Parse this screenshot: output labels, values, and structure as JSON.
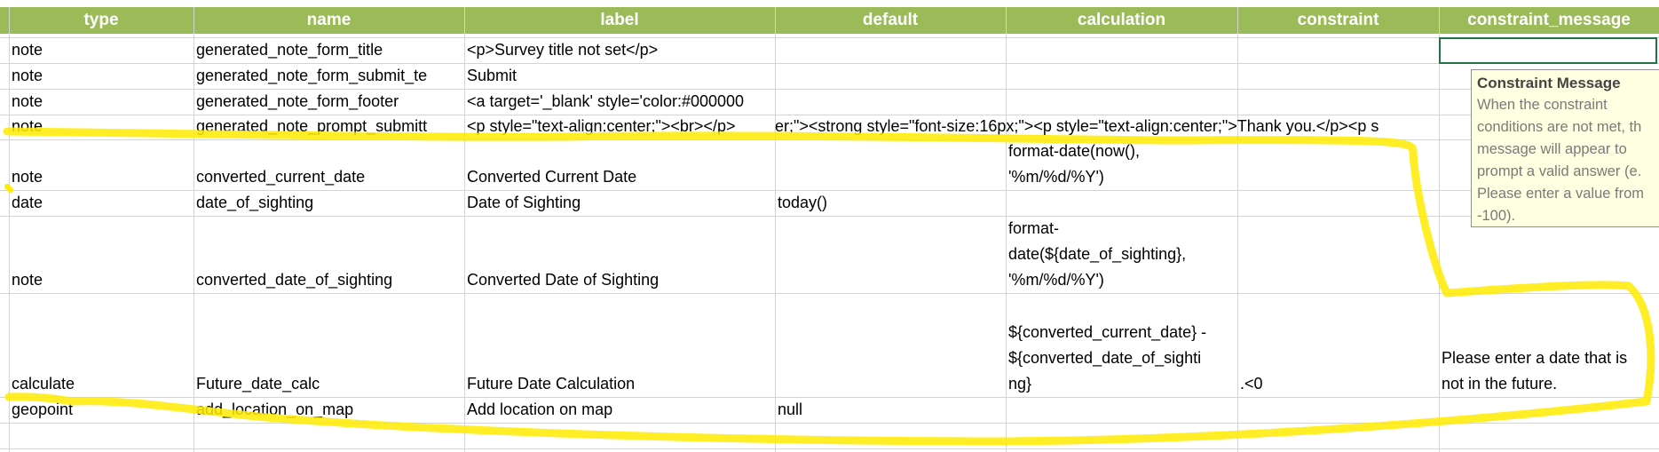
{
  "colors": {
    "header_bg": "#9bbb59",
    "header_text": "#ffffff",
    "grid": "#d4d4d4",
    "selection": "#217346",
    "tooltip_bg": "#ffffe1",
    "highlight": "#ffeb00"
  },
  "headers": [
    "type",
    "name",
    "label",
    "default",
    "calculation",
    "constraint",
    "constraint_message"
  ],
  "rows": [
    {
      "type": "note",
      "name": "generated_note_form_title",
      "label": "<p>Survey title not set</p>",
      "default": "",
      "calculation": [],
      "constraint": "",
      "constraint_message": []
    },
    {
      "type": "note",
      "name": "generated_note_form_submit_te",
      "label": "Submit",
      "default": "",
      "calculation": [],
      "constraint": "",
      "constraint_message": []
    },
    {
      "type": "note",
      "name": "generated_note_form_footer",
      "label": "<a target='_blank' style='color:#000000",
      "default": "",
      "calculation": [],
      "constraint": "",
      "constraint_message": []
    },
    {
      "type": "note",
      "name": "generated_note_prompt_submitt",
      "label": "<p style=\"text-align:center;\"><br></p>",
      "label_overflow": "er;\"><strong style=\"font-size:16px;\"><p style=\"text-align:center;\">Thank you.</p><p s",
      "default": "",
      "calculation": [],
      "constraint": "",
      "constraint_message": []
    },
    {
      "type": "note",
      "name": "converted_current_date",
      "label": "Converted Current Date",
      "default": "",
      "calculation": [
        "format-date(now(),",
        "'%m/%d/%Y')"
      ],
      "constraint": "",
      "constraint_message": []
    },
    {
      "type": "date",
      "name": "date_of_sighting",
      "label": "Date of Sighting",
      "default": "today()",
      "calculation": [],
      "constraint": "",
      "constraint_message": []
    },
    {
      "type": "note",
      "name": "converted_date_of_sighting",
      "label": "Converted Date of Sighting",
      "default": "",
      "calculation": [
        "format-",
        "date(${date_of_sighting},",
        "'%m/%d/%Y')"
      ],
      "constraint": "",
      "constraint_message": []
    },
    {
      "type": "calculate",
      "name": "Future_date_calc",
      "label": "Future Date Calculation",
      "default": "",
      "calculation": [
        "${converted_current_date} -",
        "${converted_date_of_sighti",
        "ng}"
      ],
      "constraint": ".<0",
      "constraint_message": [
        "Please enter a date that is",
        "not in the future."
      ]
    },
    {
      "type": "geopoint",
      "name": "add_location_on_map",
      "label": "Add location on map",
      "default": "null",
      "calculation": [],
      "constraint": "",
      "constraint_message": []
    }
  ],
  "tooltip": {
    "title": "Constraint Message",
    "lines": [
      "When the constraint",
      "conditions are not met, th",
      "message will appear to",
      "prompt a valid answer (e.",
      "Please enter a value from",
      "-100)."
    ]
  }
}
